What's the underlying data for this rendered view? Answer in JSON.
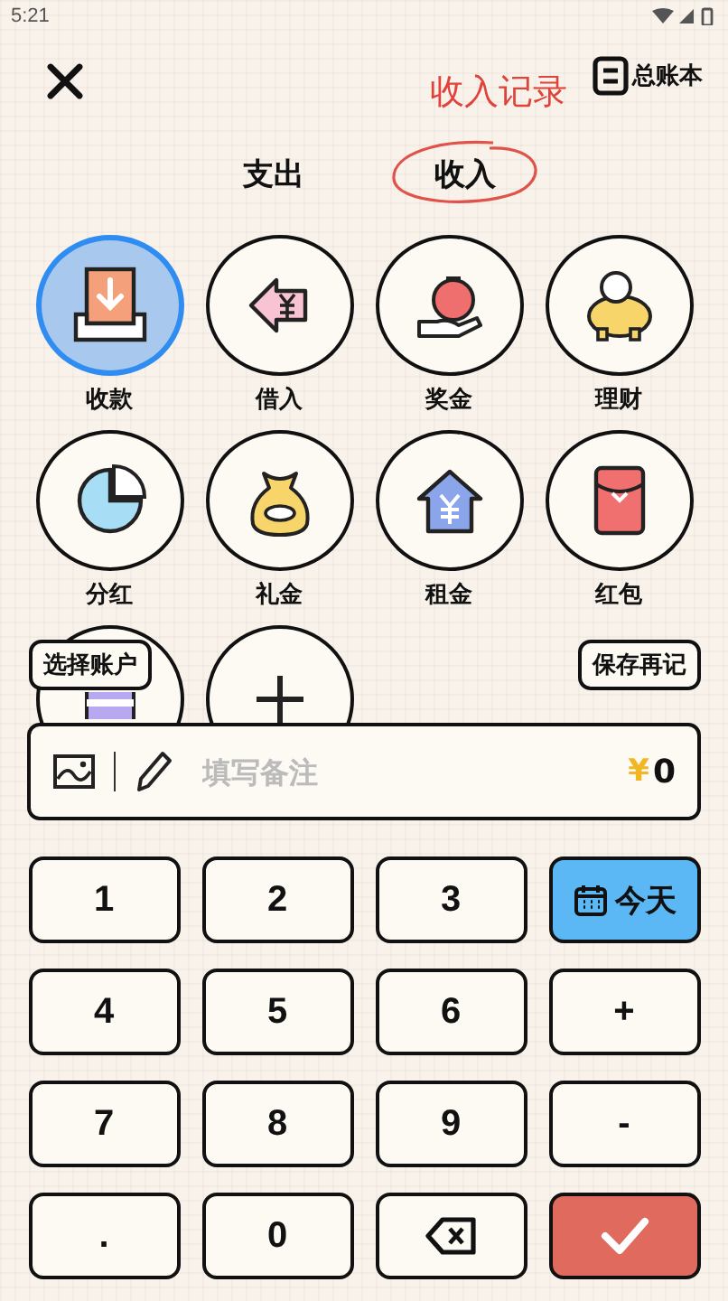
{
  "status_bar": {
    "time": "5:21"
  },
  "header": {
    "title": "收入记录",
    "ledger_label": "总账本"
  },
  "tabs": [
    {
      "label": "支出",
      "selected": false
    },
    {
      "label": "收入",
      "selected": true
    }
  ],
  "categories": [
    {
      "kind": "category",
      "label": "收款",
      "selected": true
    },
    {
      "kind": "category",
      "label": "借入",
      "selected": false
    },
    {
      "kind": "category",
      "label": "奖金",
      "selected": false
    },
    {
      "kind": "category",
      "label": "理财",
      "selected": false
    },
    {
      "kind": "category",
      "label": "分红",
      "selected": false
    },
    {
      "kind": "category",
      "label": "礼金",
      "selected": false
    },
    {
      "kind": "category",
      "label": "租金",
      "selected": false
    },
    {
      "kind": "category",
      "label": "红包",
      "selected": false
    },
    {
      "kind": "category",
      "selected": false
    },
    {
      "kind": "add"
    }
  ],
  "choose_account_button": "选择账户",
  "save_again_button": "保存再记",
  "memo": {
    "placeholder": "填写备注",
    "currency": "¥",
    "amount": "0"
  },
  "keypad": [
    {
      "kind": "key",
      "label": "1"
    },
    {
      "kind": "key",
      "label": "2"
    },
    {
      "kind": "key",
      "label": "3"
    },
    {
      "kind": "today",
      "label": "今天"
    },
    {
      "kind": "key",
      "label": "4"
    },
    {
      "kind": "key",
      "label": "5"
    },
    {
      "kind": "key",
      "label": "6"
    },
    {
      "kind": "key",
      "label": "+"
    },
    {
      "kind": "key",
      "label": "7"
    },
    {
      "kind": "key",
      "label": "8"
    },
    {
      "kind": "key",
      "label": "9"
    },
    {
      "kind": "key",
      "label": "-"
    },
    {
      "kind": "key",
      "label": "."
    },
    {
      "kind": "key",
      "label": "0"
    },
    {
      "kind": "backspace"
    },
    {
      "kind": "confirm"
    }
  ]
}
